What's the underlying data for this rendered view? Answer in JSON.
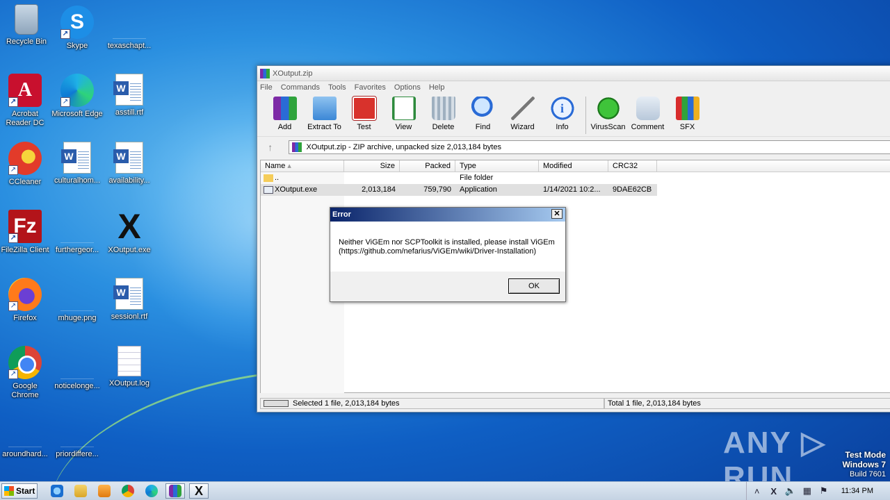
{
  "desktop": {
    "icons": [
      {
        "label": "Recycle Bin"
      },
      {
        "label": "Skype"
      },
      {
        "label": "texaschapt..."
      },
      {
        "label": "Acrobat Reader DC"
      },
      {
        "label": "Microsoft Edge"
      },
      {
        "label": "asstill.rtf"
      },
      {
        "label": "CCleaner"
      },
      {
        "label": "culturalhom..."
      },
      {
        "label": "availability..."
      },
      {
        "label": "FileZilla Client"
      },
      {
        "label": "furthergeor..."
      },
      {
        "label": "XOutput.exe"
      },
      {
        "label": "Firefox"
      },
      {
        "label": "mhuge.png"
      },
      {
        "label": "sessionl.rtf"
      },
      {
        "label": "Google Chrome"
      },
      {
        "label": "noticelonge..."
      },
      {
        "label": "XOutput.log"
      },
      {
        "label": "aroundhard..."
      },
      {
        "label": "priordiffere..."
      }
    ]
  },
  "winrar": {
    "title": "XOutput.zip",
    "menu": [
      "File",
      "Commands",
      "Tools",
      "Favorites",
      "Options",
      "Help"
    ],
    "toolbar": [
      "Add",
      "Extract To",
      "Test",
      "View",
      "Delete",
      "Find",
      "Wizard",
      "Info",
      "VirusScan",
      "Comment",
      "SFX"
    ],
    "address": "XOutput.zip - ZIP archive, unpacked size 2,013,184 bytes",
    "columns": [
      "Name",
      "Size",
      "Packed",
      "Type",
      "Modified",
      "CRC32"
    ],
    "rows": [
      {
        "name": "..",
        "size": "",
        "packed": "",
        "type": "File folder",
        "modified": "",
        "crc": ""
      },
      {
        "name": "XOutput.exe",
        "size": "2,013,184",
        "packed": "759,790",
        "type": "Application",
        "modified": "1/14/2021 10:2...",
        "crc": "9DAE62CB"
      }
    ],
    "status_left": "Selected 1 file, 2,013,184 bytes",
    "status_right": "Total 1 file, 2,013,184 bytes"
  },
  "dialog": {
    "title": "Error",
    "line1": "Neither ViGEm nor SCPToolkit is installed, please install ViGEm",
    "line2": "(https://github.com/nefarius/ViGEm/wiki/Driver-Installation)",
    "ok": "OK",
    "close": "✕"
  },
  "watermark": "ANY ▷ RUN",
  "testmode": {
    "line1": "Test Mode",
    "line2": "Windows 7",
    "line3": "Build 7601"
  },
  "taskbar": {
    "start": "Start",
    "clock": "11:34 PM"
  },
  "colors": {
    "dialog_title": "#0a246a",
    "desktop": "#1e73d2"
  }
}
